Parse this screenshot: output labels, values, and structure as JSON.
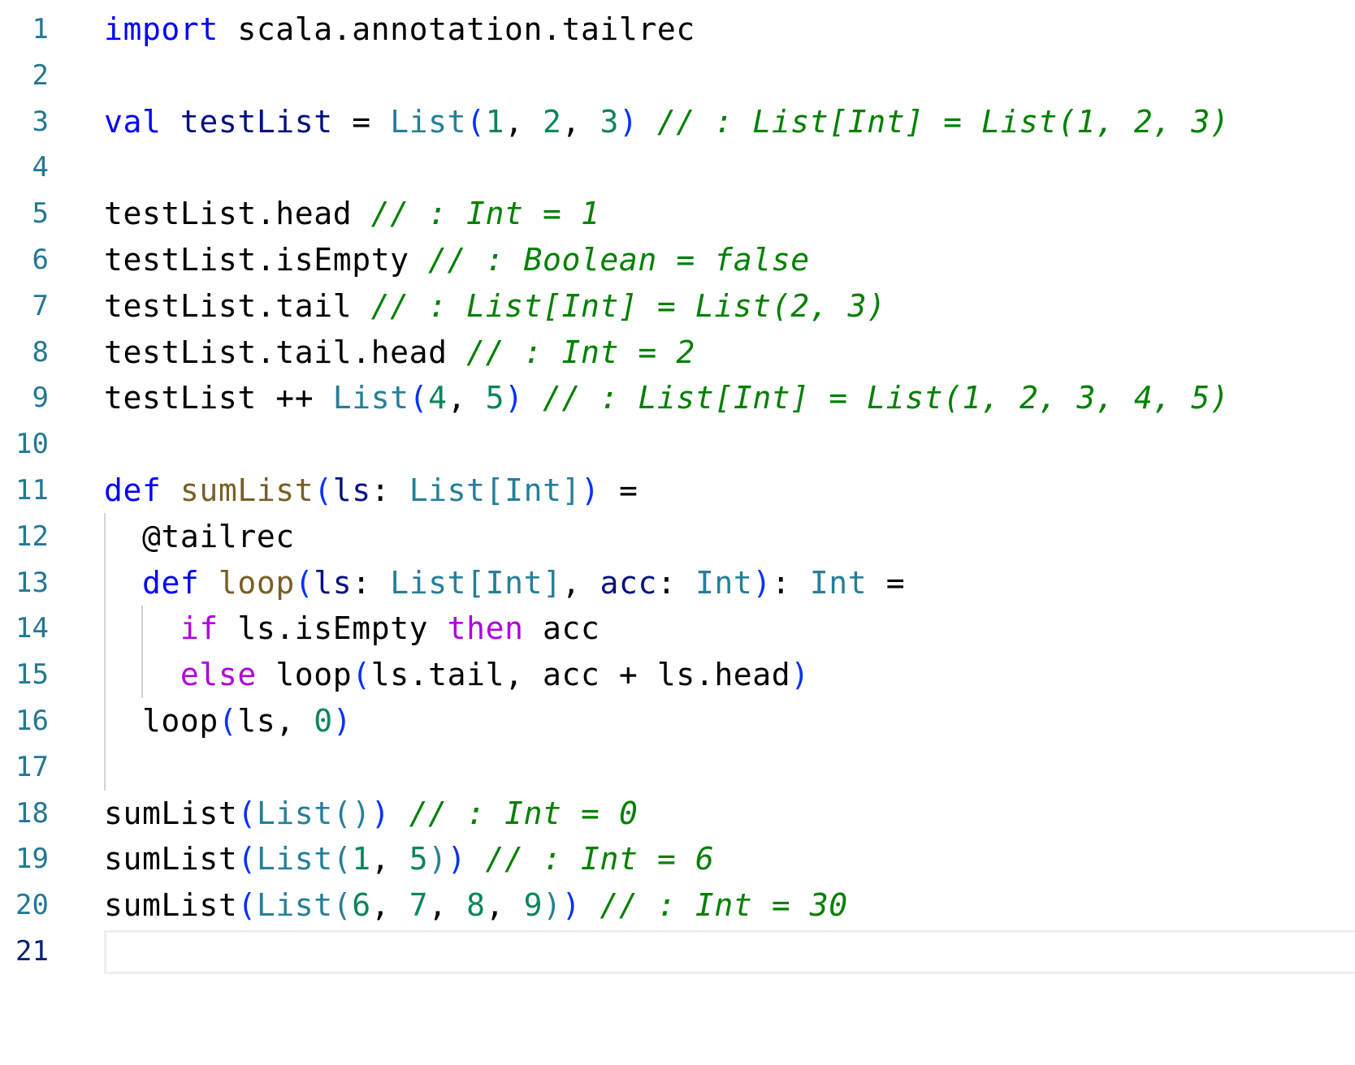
{
  "editor": {
    "language": "scala",
    "active_line": 21,
    "lines": [
      {
        "n": "1",
        "tokens": [
          [
            "kw",
            "import"
          ],
          [
            "t",
            " scala.annotation.tailrec"
          ]
        ]
      },
      {
        "n": "2",
        "tokens": []
      },
      {
        "n": "3",
        "tokens": [
          [
            "kw",
            "val"
          ],
          [
            "t",
            " "
          ],
          [
            "var",
            "testList"
          ],
          [
            "t",
            " = "
          ],
          [
            "typ",
            "List"
          ],
          [
            "br",
            "("
          ],
          [
            "num",
            "1"
          ],
          [
            "t",
            ", "
          ],
          [
            "num",
            "2"
          ],
          [
            "t",
            ", "
          ],
          [
            "num",
            "3"
          ],
          [
            "br",
            ")"
          ],
          [
            "t",
            " "
          ],
          [
            "cmt",
            "// : List[Int] = List(1, 2, 3)"
          ]
        ]
      },
      {
        "n": "4",
        "tokens": []
      },
      {
        "n": "5",
        "tokens": [
          [
            "t",
            "testList.head "
          ],
          [
            "cmt",
            "// : Int = 1"
          ]
        ]
      },
      {
        "n": "6",
        "tokens": [
          [
            "t",
            "testList.isEmpty "
          ],
          [
            "cmt",
            "// : Boolean = false"
          ]
        ]
      },
      {
        "n": "7",
        "tokens": [
          [
            "t",
            "testList.tail "
          ],
          [
            "cmt",
            "// : List[Int] = List(2, 3)"
          ]
        ]
      },
      {
        "n": "8",
        "tokens": [
          [
            "t",
            "testList.tail.head "
          ],
          [
            "cmt",
            "// : Int = 2"
          ]
        ]
      },
      {
        "n": "9",
        "tokens": [
          [
            "t",
            "testList ++ "
          ],
          [
            "typ",
            "List"
          ],
          [
            "br",
            "("
          ],
          [
            "num",
            "4"
          ],
          [
            "t",
            ", "
          ],
          [
            "num",
            "5"
          ],
          [
            "br",
            ")"
          ],
          [
            "t",
            " "
          ],
          [
            "cmt",
            "// : List[Int] = List(1, 2, 3, 4, 5)"
          ]
        ]
      },
      {
        "n": "10",
        "tokens": []
      },
      {
        "n": "11",
        "tokens": [
          [
            "kw",
            "def"
          ],
          [
            "t",
            " "
          ],
          [
            "fn",
            "sumList"
          ],
          [
            "br",
            "("
          ],
          [
            "var",
            "ls"
          ],
          [
            "t",
            ": "
          ],
          [
            "typ",
            "List"
          ],
          [
            "typ",
            "["
          ],
          [
            "typ",
            "Int"
          ],
          [
            "typ",
            "]"
          ],
          [
            "br",
            ")"
          ],
          [
            "t",
            " ="
          ]
        ]
      },
      {
        "n": "12",
        "tokens": [
          [
            "t",
            "  @tailrec"
          ]
        ]
      },
      {
        "n": "13",
        "tokens": [
          [
            "t",
            "  "
          ],
          [
            "kw",
            "def"
          ],
          [
            "t",
            " "
          ],
          [
            "fn",
            "loop"
          ],
          [
            "br",
            "("
          ],
          [
            "var",
            "ls"
          ],
          [
            "t",
            ": "
          ],
          [
            "typ",
            "List"
          ],
          [
            "typ",
            "["
          ],
          [
            "typ",
            "Int"
          ],
          [
            "typ",
            "]"
          ],
          [
            "t",
            ", "
          ],
          [
            "var",
            "acc"
          ],
          [
            "t",
            ": "
          ],
          [
            "typ",
            "Int"
          ],
          [
            "br",
            ")"
          ],
          [
            "t",
            ": "
          ],
          [
            "typ",
            "Int"
          ],
          [
            "t",
            " ="
          ]
        ]
      },
      {
        "n": "14",
        "tokens": [
          [
            "t",
            "    "
          ],
          [
            "kwc",
            "if"
          ],
          [
            "t",
            " ls.isEmpty "
          ],
          [
            "kwc",
            "then"
          ],
          [
            "t",
            " acc"
          ]
        ]
      },
      {
        "n": "15",
        "tokens": [
          [
            "t",
            "    "
          ],
          [
            "kwc",
            "else"
          ],
          [
            "t",
            " loop"
          ],
          [
            "br",
            "("
          ],
          [
            "t",
            "ls.tail, acc + ls.head"
          ],
          [
            "br",
            ")"
          ]
        ]
      },
      {
        "n": "16",
        "tokens": [
          [
            "t",
            "  loop"
          ],
          [
            "br",
            "("
          ],
          [
            "t",
            "ls, "
          ],
          [
            "num",
            "0"
          ],
          [
            "br",
            ")"
          ]
        ]
      },
      {
        "n": "17",
        "tokens": []
      },
      {
        "n": "18",
        "tokens": [
          [
            "t",
            "sumList"
          ],
          [
            "br",
            "("
          ],
          [
            "typ",
            "List"
          ],
          [
            "typ",
            "()"
          ],
          [
            "br",
            ")"
          ],
          [
            "t",
            " "
          ],
          [
            "cmt",
            "// : Int = 0"
          ]
        ]
      },
      {
        "n": "19",
        "tokens": [
          [
            "t",
            "sumList"
          ],
          [
            "br",
            "("
          ],
          [
            "typ",
            "List"
          ],
          [
            "typ",
            "("
          ],
          [
            "num",
            "1"
          ],
          [
            "t",
            ", "
          ],
          [
            "num",
            "5"
          ],
          [
            "typ",
            ")"
          ],
          [
            "br",
            ")"
          ],
          [
            "t",
            " "
          ],
          [
            "cmt",
            "// : Int = 6"
          ]
        ]
      },
      {
        "n": "20",
        "tokens": [
          [
            "t",
            "sumList"
          ],
          [
            "br",
            "("
          ],
          [
            "typ",
            "List"
          ],
          [
            "typ",
            "("
          ],
          [
            "num",
            "6"
          ],
          [
            "t",
            ", "
          ],
          [
            "num",
            "7"
          ],
          [
            "t",
            ", "
          ],
          [
            "num",
            "8"
          ],
          [
            "t",
            ", "
          ],
          [
            "num",
            "9"
          ],
          [
            "typ",
            ")"
          ],
          [
            "br",
            ")"
          ],
          [
            "t",
            " "
          ],
          [
            "cmt",
            "// : Int = 30"
          ]
        ]
      },
      {
        "n": "21",
        "tokens": []
      }
    ]
  }
}
